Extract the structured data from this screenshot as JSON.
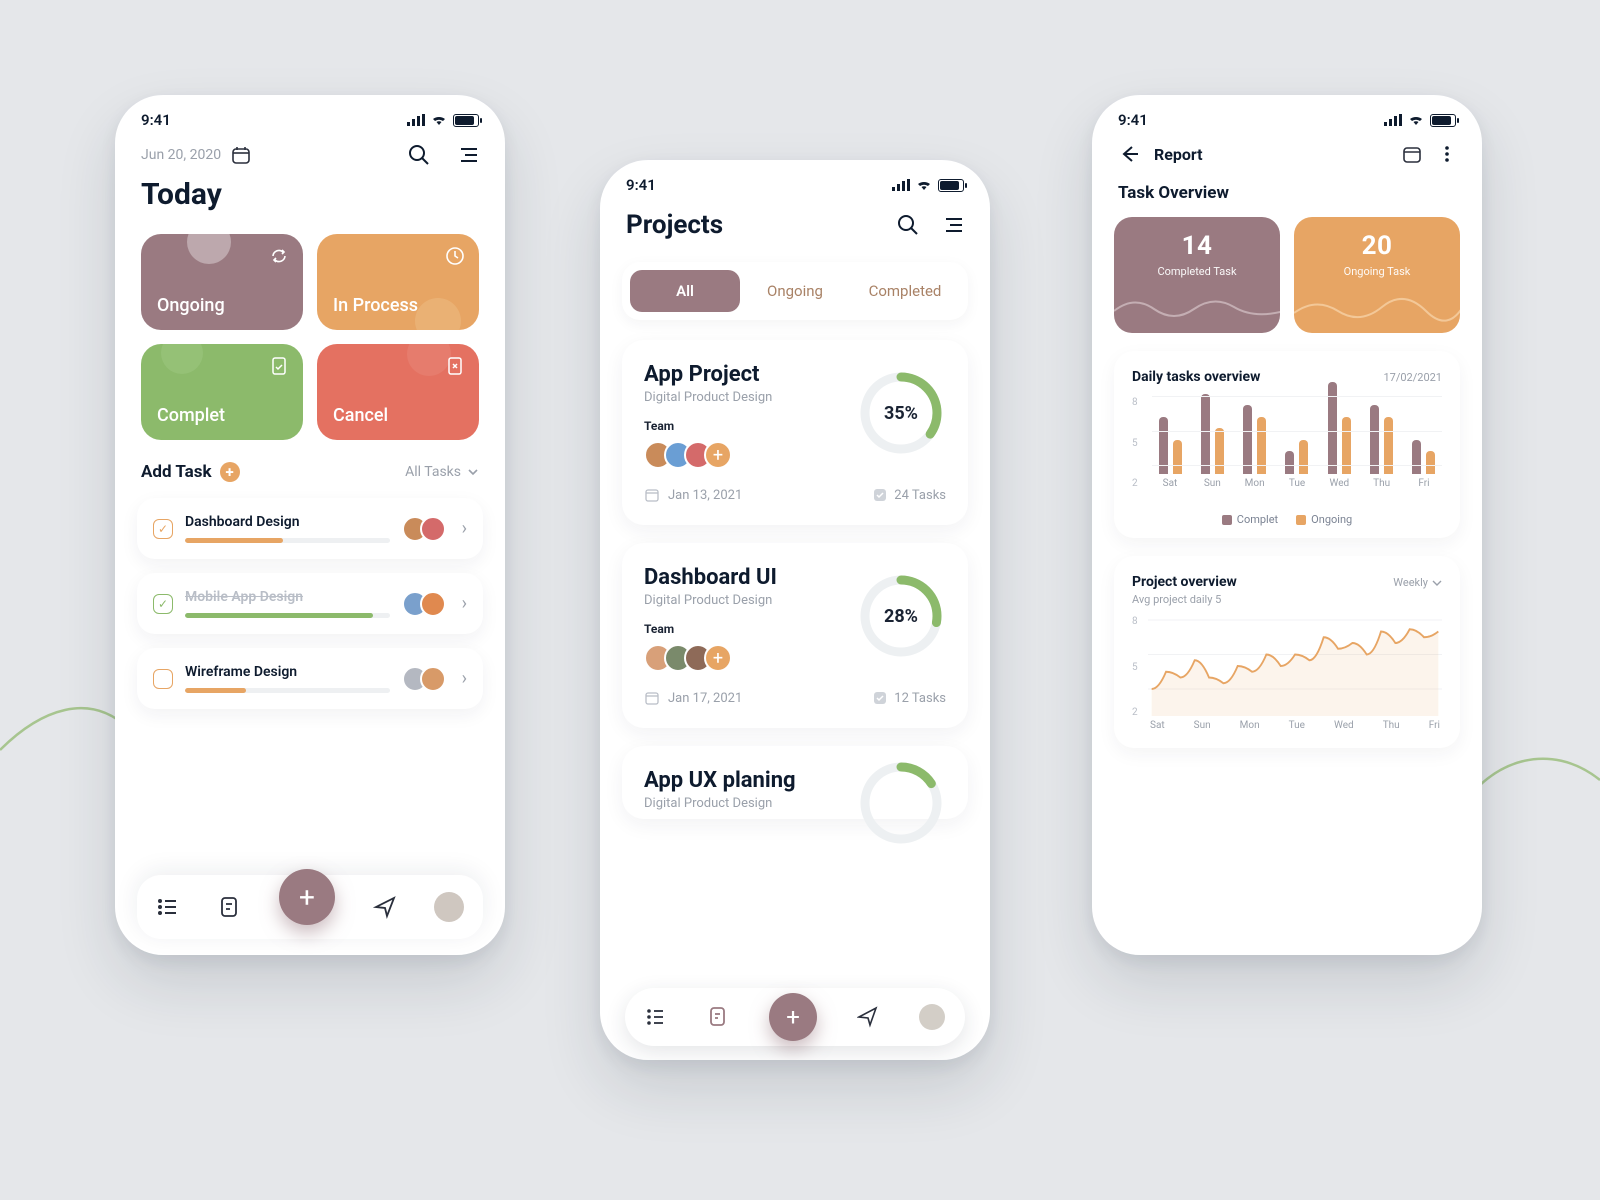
{
  "status_time": "9:41",
  "colors": {
    "mauve": "#9a7a81",
    "orange": "#e7a564",
    "green": "#8cba6b",
    "red": "#e47161",
    "text": "#0e1b2e",
    "muted": "#9aa0aa"
  },
  "screen1": {
    "date": "Jun 20, 2020",
    "title": "Today",
    "cards": {
      "ongoing": "Ongoing",
      "inprocess": "In Process",
      "complete": "Complet",
      "cancel": "Cancel"
    },
    "add_task": "Add Task",
    "all_tasks": "All Tasks",
    "tasks": {
      "t0": {
        "title": "Dashboard Design",
        "progress_pct": 48,
        "bar_color": "#e7a564",
        "checked": true,
        "tick_color": "orange"
      },
      "t1": {
        "title": "Mobile App Design",
        "progress_pct": 92,
        "bar_color": "#8cba6b",
        "checked": true,
        "tick_color": "green",
        "done": true
      },
      "t2": {
        "title": "Wireframe Design",
        "progress_pct": 30,
        "bar_color": "#e7a564",
        "checked": false
      }
    }
  },
  "screen2": {
    "title": "Projects",
    "tabs": {
      "all": "All",
      "ongoing": "Ongoing",
      "completed": "Completed"
    },
    "projects": {
      "p0": {
        "title": "App Project",
        "subtitle": "Digital Product Design",
        "team_label": "Team",
        "date": "Jan 13, 2021",
        "task_count_label": "24 Tasks",
        "progress": 35,
        "progress_label": "35%"
      },
      "p1": {
        "title": "Dashboard UI",
        "subtitle": "Digital Product Design",
        "team_label": "Team",
        "date": "Jan 17, 2021",
        "task_count_label": "12 Tasks",
        "progress": 28,
        "progress_label": "28%"
      },
      "p2": {
        "title": "App UX planing",
        "subtitle": "Digital Product Design"
      }
    }
  },
  "screen3": {
    "back_label": "Report",
    "overview_label": "Task Overview",
    "stats": {
      "completed": {
        "value": "14",
        "label": "Completed Task"
      },
      "ongoing": {
        "value": "20",
        "label": "Ongoing Task"
      }
    },
    "daily": {
      "title": "Daily tasks overview",
      "date": "17/02/2021",
      "legend_complete": "Complet",
      "legend_ongoing": "Ongoing"
    },
    "project_overview": {
      "title": "Project overview",
      "subtitle": "Avg project daily 5",
      "filter": "Weekly"
    }
  },
  "chart_data": [
    {
      "type": "bar",
      "title": "Daily tasks overview",
      "ylabel": "",
      "ylim": [
        0,
        8
      ],
      "yticks": [
        2,
        5,
        8
      ],
      "categories": [
        "Sat",
        "Sun",
        "Mon",
        "Tue",
        "Wed",
        "Thu",
        "Fri"
      ],
      "series": [
        {
          "name": "Complet",
          "color": "#9a7a81",
          "values": [
            5,
            7,
            6,
            2,
            8,
            6,
            3
          ]
        },
        {
          "name": "Ongoing",
          "color": "#e7a564",
          "values": [
            3,
            4,
            5,
            3,
            5,
            5,
            2
          ]
        }
      ]
    },
    {
      "type": "line",
      "title": "Project overview",
      "ylim": [
        0,
        8
      ],
      "yticks": [
        2,
        5,
        8
      ],
      "categories": [
        "Sat",
        "Sun",
        "Mon",
        "Tue",
        "Wed",
        "Thu",
        "Fri"
      ],
      "series": [
        {
          "name": "Ongoing",
          "color": "#e7a564",
          "values": [
            2.0,
            3.5,
            3.0,
            4.5,
            3.0,
            2.5,
            4.0,
            3.5,
            5.0,
            4.0,
            5.0,
            4.5,
            6.5,
            5.5,
            6.0,
            5.0,
            7.0,
            6.0,
            7.2,
            6.5,
            7.0
          ]
        }
      ]
    }
  ]
}
